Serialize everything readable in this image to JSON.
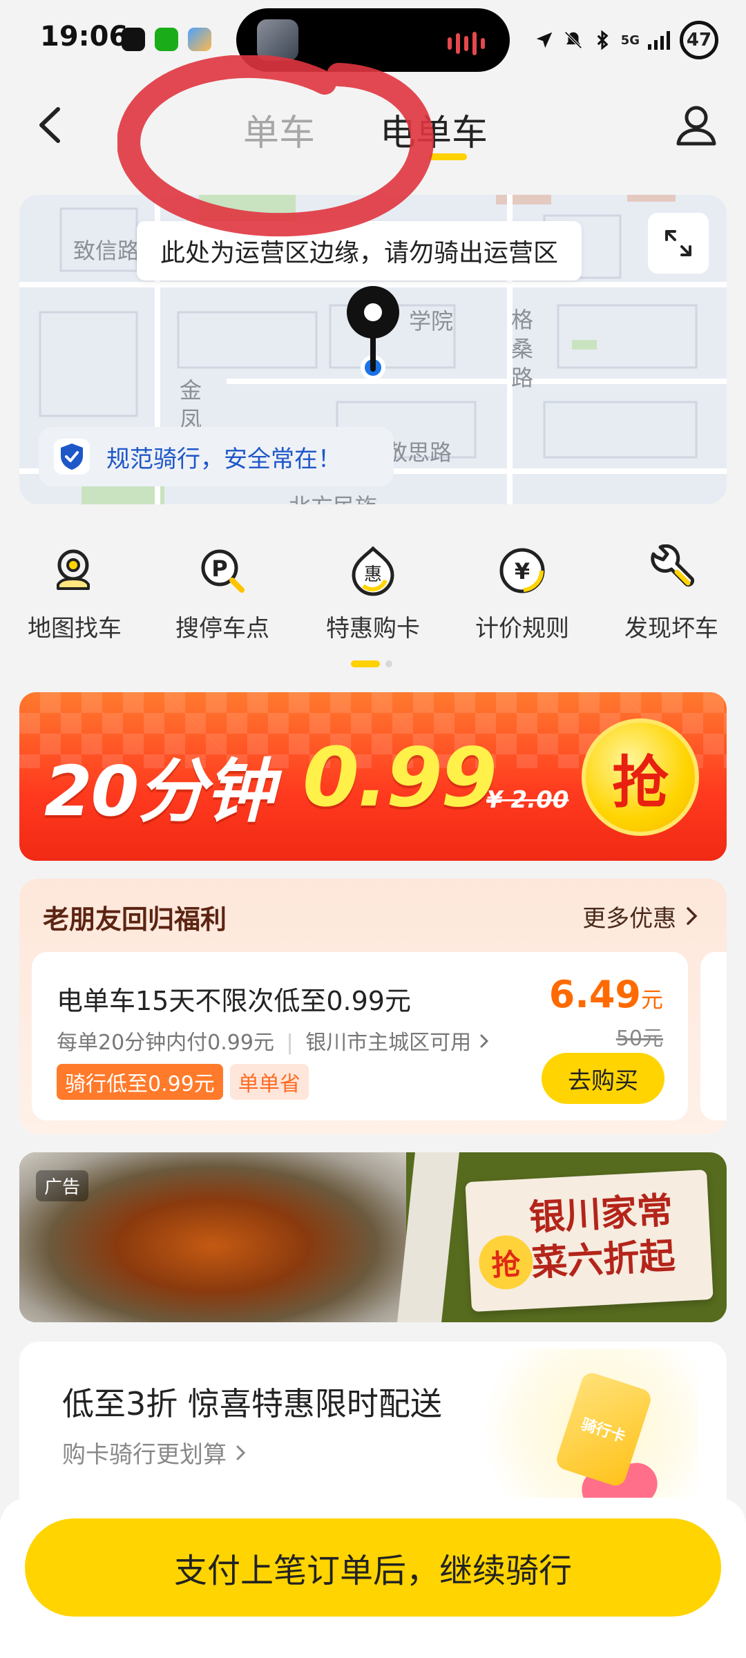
{
  "status_bar": {
    "time": "19:06",
    "signal": "5G",
    "battery": "47"
  },
  "header": {
    "tab_bike": "单车",
    "tab_ebike": "电单车",
    "active_tab": "电单车"
  },
  "map": {
    "tip": "此处为运营区边缘，请勿骑出运营区",
    "road_labels": [
      "致信路",
      "格桑路",
      "金凤",
      "学院",
      "敬思路",
      "北方民族"
    ],
    "safety_text": "规范骑行，安全常在！"
  },
  "tools": [
    {
      "label": "地图找车",
      "icon": "map-pin-search-icon"
    },
    {
      "label": "搜停车点",
      "icon": "parking-search-icon"
    },
    {
      "label": "特惠购卡",
      "icon": "discount-card-icon"
    },
    {
      "label": "计价规则",
      "icon": "yuan-icon"
    },
    {
      "label": "发现坏车",
      "icon": "wrench-icon"
    }
  ],
  "pager": {
    "pages": 2,
    "current": 1
  },
  "promo": {
    "duration": "20分钟",
    "price": "0.99",
    "old_price": "¥ 2.00",
    "grab": "抢"
  },
  "welfare": {
    "title": "老朋友回归福利",
    "more": "更多优惠",
    "offer": {
      "title": "电单车15天不限次低至0.99元",
      "sub_left": "每单20分钟内付0.99元",
      "sub_right": "银川市主城区可用",
      "tag1": "骑行低至0.99元",
      "tag2": "单单省",
      "price": "6.49",
      "price_unit": "元",
      "old_price": "50元",
      "buy": "去购买"
    }
  },
  "ad": {
    "label": "广告",
    "line1": "银川家常",
    "line2": "菜六折起",
    "grab": "抢"
  },
  "card_promo": {
    "title": "低至3折  惊喜特惠限时配送",
    "sub": "购卡骑行更划算",
    "card_text": "骑行卡"
  },
  "cta": {
    "label": "支付上笔订单后，继续骑行"
  },
  "colors": {
    "brand_yellow": "#ffd400",
    "promo_red": "#ff3a1f",
    "accent_orange": "#ff6a00",
    "safety_blue": "#1e57c8"
  }
}
